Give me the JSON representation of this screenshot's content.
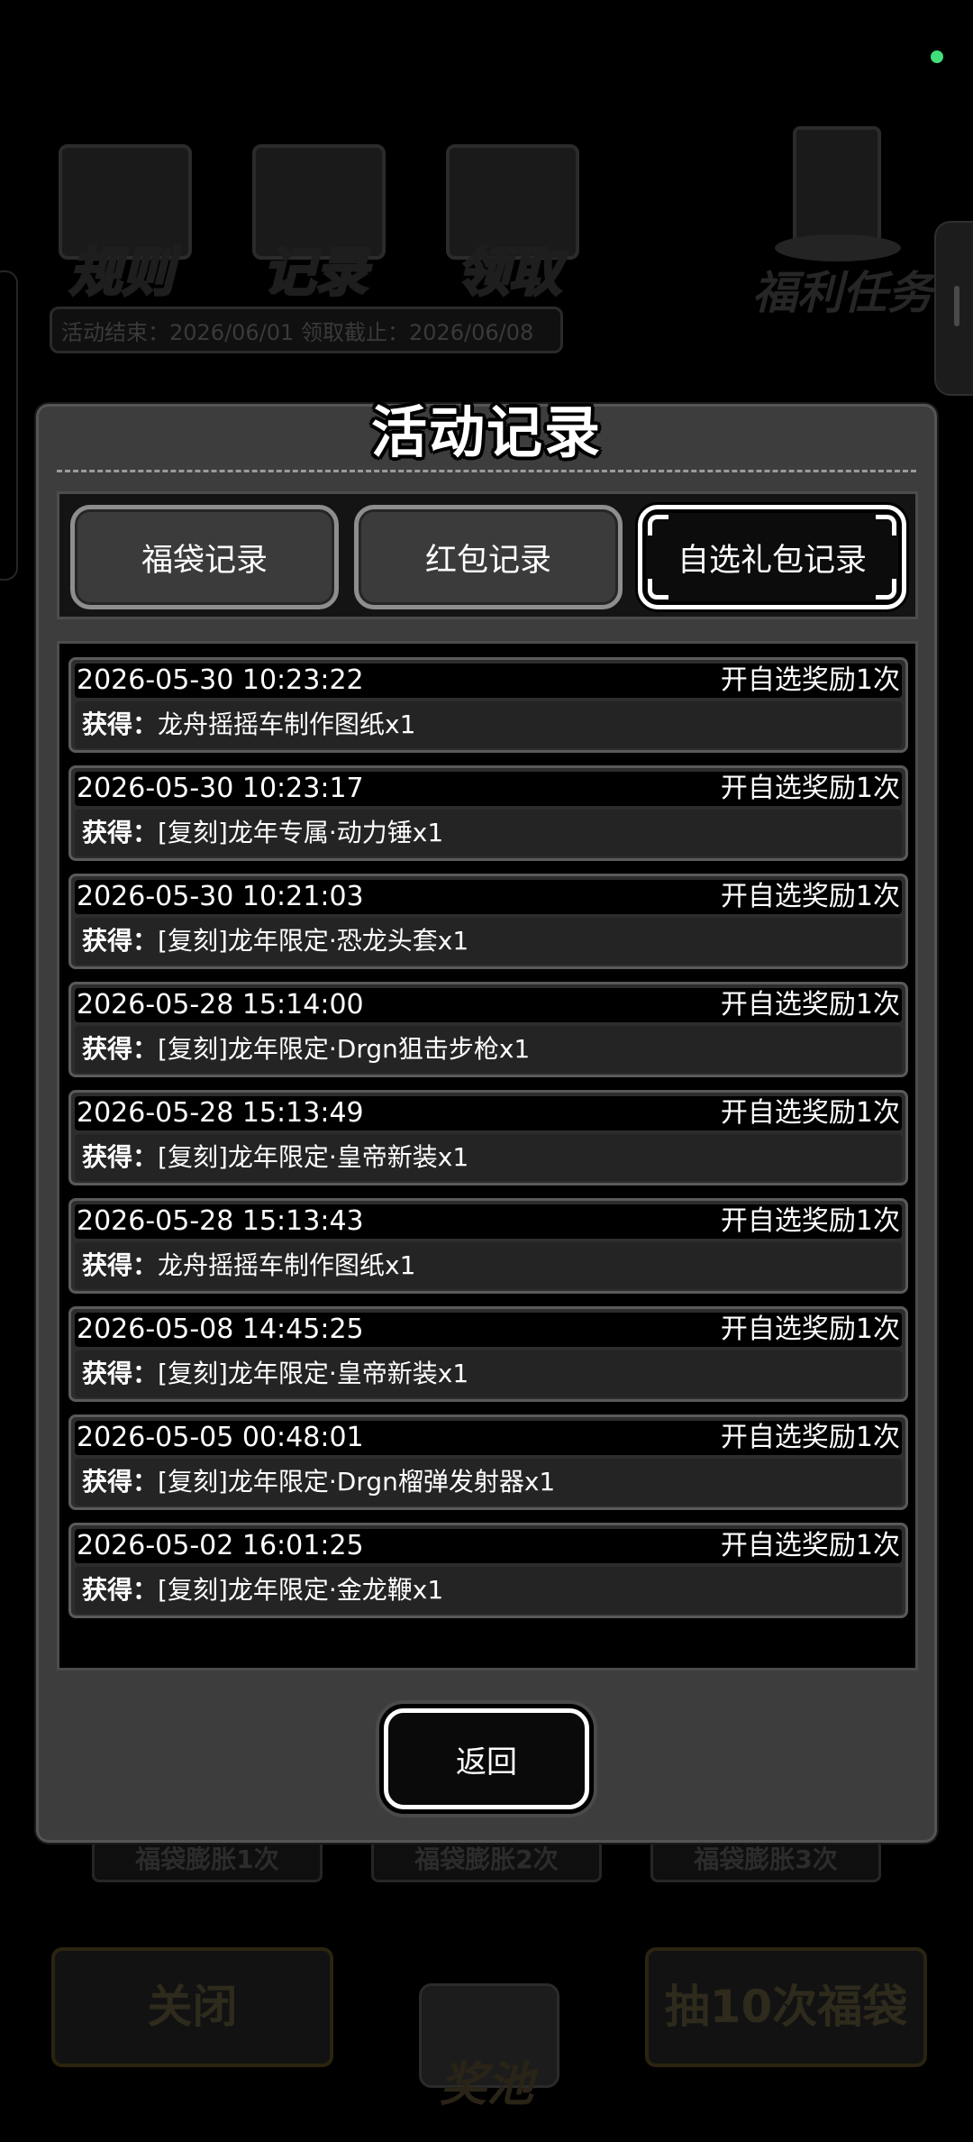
{
  "background": {
    "icons": [
      {
        "label": "规则",
        "icon": "rulebook-icon"
      },
      {
        "label": "记录",
        "icon": "notepad-icon"
      },
      {
        "label": "领取",
        "icon": "box-icon"
      }
    ],
    "welfare_label": "福利任务",
    "dates_text": "活动结束：2026/06/01  领取截止：2026/06/08",
    "chips": [
      "福袋膨胀1次",
      "福袋膨胀2次",
      "福袋膨胀3次"
    ],
    "close_label": "关闭",
    "pool_label": "奖池",
    "draw10_label": "抽10次福袋"
  },
  "modal": {
    "title": "活动记录",
    "tabs": [
      {
        "label": "福袋记录",
        "active": false
      },
      {
        "label": "红包记录",
        "active": false
      },
      {
        "label": "自选礼包记录",
        "active": true
      }
    ],
    "obtained_prefix": "获得：",
    "records": [
      {
        "time": "2026-05-30 10:23:22",
        "tag": "开自选奖励1次",
        "item": "龙舟摇摇车制作图纸x1"
      },
      {
        "time": "2026-05-30 10:23:17",
        "tag": "开自选奖励1次",
        "item": "[复刻]龙年专属·动力锤x1"
      },
      {
        "time": "2026-05-30 10:21:03",
        "tag": "开自选奖励1次",
        "item": "[复刻]龙年限定·恐龙头套x1"
      },
      {
        "time": "2026-05-28 15:14:00",
        "tag": "开自选奖励1次",
        "item": "[复刻]龙年限定·Drgn狙击步枪x1"
      },
      {
        "time": "2026-05-28 15:13:49",
        "tag": "开自选奖励1次",
        "item": "[复刻]龙年限定·皇帝新装x1"
      },
      {
        "time": "2026-05-28 15:13:43",
        "tag": "开自选奖励1次",
        "item": "龙舟摇摇车制作图纸x1"
      },
      {
        "time": "2026-05-08 14:45:25",
        "tag": "开自选奖励1次",
        "item": "[复刻]龙年限定·皇帝新装x1"
      },
      {
        "time": "2026-05-05 00:48:01",
        "tag": "开自选奖励1次",
        "item": "[复刻]龙年限定·Drgn榴弹发射器x1"
      },
      {
        "time": "2026-05-02 16:01:25",
        "tag": "开自选奖励1次",
        "item": "[复刻]龙年限定·金龙鞭x1"
      }
    ],
    "back_label": "返回"
  }
}
